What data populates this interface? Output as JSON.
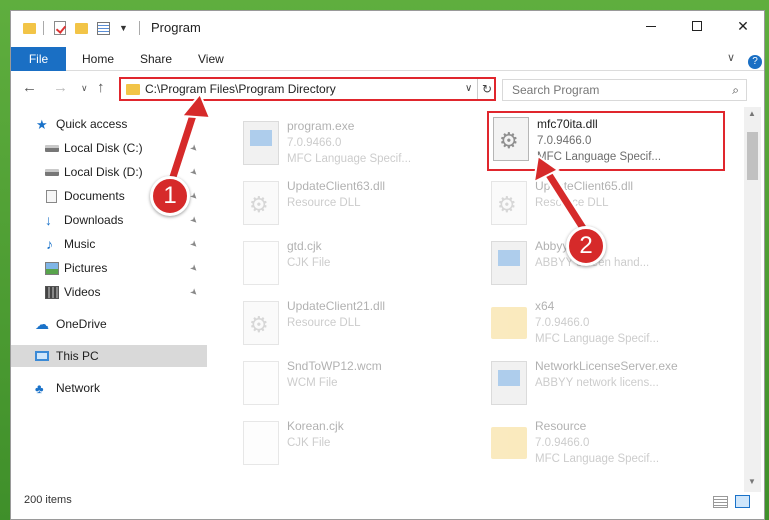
{
  "window": {
    "title": "Program",
    "buttons": {
      "minimize_icon": "minimize-icon",
      "maximize_icon": "maximize-icon",
      "close_glyph": "✕"
    }
  },
  "ribbon": {
    "tabs": [
      {
        "label": "File",
        "active": true
      },
      {
        "label": "Home"
      },
      {
        "label": "Share"
      },
      {
        "label": "View"
      }
    ],
    "expand_glyph": "∨",
    "help_glyph": "?"
  },
  "navigation": {
    "back": "←",
    "forward": "→",
    "recent": "∨",
    "up": "↑",
    "address": "C:\\Program Files\\Program Directory",
    "address_dropdown": "∨",
    "refresh": "↻"
  },
  "search": {
    "placeholder": "Search Program",
    "icon": "⌕"
  },
  "sidebar": {
    "items": [
      {
        "label": "Quick access",
        "icon": "star-icon",
        "glyph": "★"
      },
      {
        "label": "Local Disk (C:)",
        "icon": "disk-icon",
        "pinned": true
      },
      {
        "label": "Local Disk (D:)",
        "icon": "disk-icon",
        "pinned": true
      },
      {
        "label": "Documents",
        "icon": "document-icon",
        "pinned": true
      },
      {
        "label": "Downloads",
        "icon": "download-icon",
        "glyph": "↓",
        "pinned": true
      },
      {
        "label": "Music",
        "icon": "music-icon",
        "glyph": "♪",
        "pinned": true
      },
      {
        "label": "Pictures",
        "icon": "pictures-icon",
        "pinned": true
      },
      {
        "label": "Videos",
        "icon": "videos-icon",
        "pinned": true
      },
      {
        "label": "OneDrive",
        "icon": "cloud-icon",
        "glyph": "☁"
      },
      {
        "label": "This PC",
        "icon": "computer-icon",
        "selected": true
      },
      {
        "label": "Network",
        "icon": "network-icon",
        "glyph": "♣"
      }
    ],
    "pin_glyph": "📌"
  },
  "files": [
    {
      "name": "program.exe",
      "line2": "7.0.9466.0",
      "line3": "MFC Language Specif...",
      "icon": "application-icon",
      "faded": true
    },
    {
      "name": "mfc70ita.dll",
      "line2": "7.0.9466.0",
      "line3": "MFC Language Specif...",
      "icon": "dll-file-icon",
      "selected": true
    },
    {
      "name": "UpdateClient63.dll",
      "line2": "Resource DLL",
      "line3": "",
      "icon": "dll-file-icon",
      "faded": true
    },
    {
      "name": "UpdateClient65.dll",
      "line2": "Resource DLL",
      "line3": "",
      "icon": "dll-file-icon",
      "faded": true
    },
    {
      "name": "gtd.cjk",
      "line2": "CJK File",
      "line3": "",
      "icon": "blank-file-icon",
      "faded": true
    },
    {
      "name": "Abbyy...ew",
      "line2": "ABBYY screen hand...",
      "line3": "",
      "icon": "application-icon",
      "faded": true
    },
    {
      "name": "UpdateClient21.dll",
      "line2": "Resource DLL",
      "line3": "",
      "icon": "dll-file-icon",
      "faded": true
    },
    {
      "name": "x64",
      "line2": "7.0.9466.0",
      "line3": "MFC Language Specif...",
      "icon": "folder-icon",
      "faded": true
    },
    {
      "name": "SndToWP12.wcm",
      "line2": "WCM File",
      "line3": "",
      "icon": "blank-file-icon",
      "faded": true
    },
    {
      "name": "NetworkLicenseServer.exe",
      "line2": "ABBYY network licens...",
      "line3": "",
      "icon": "application-icon",
      "faded": true
    },
    {
      "name": "Korean.cjk",
      "line2": "CJK File",
      "line3": "",
      "icon": "blank-file-icon",
      "faded": true
    },
    {
      "name": "Resource",
      "line2": "7.0.9466.0",
      "line3": "MFC Language Specif...",
      "icon": "folder-icon",
      "faded": true
    }
  ],
  "status": {
    "item_count": "200 items"
  },
  "annotations": [
    {
      "number": "1"
    },
    {
      "number": "2"
    }
  ],
  "colors": {
    "accent": "#1a6fc4",
    "highlight": "#e0262d",
    "callout": "#d62a2a"
  }
}
